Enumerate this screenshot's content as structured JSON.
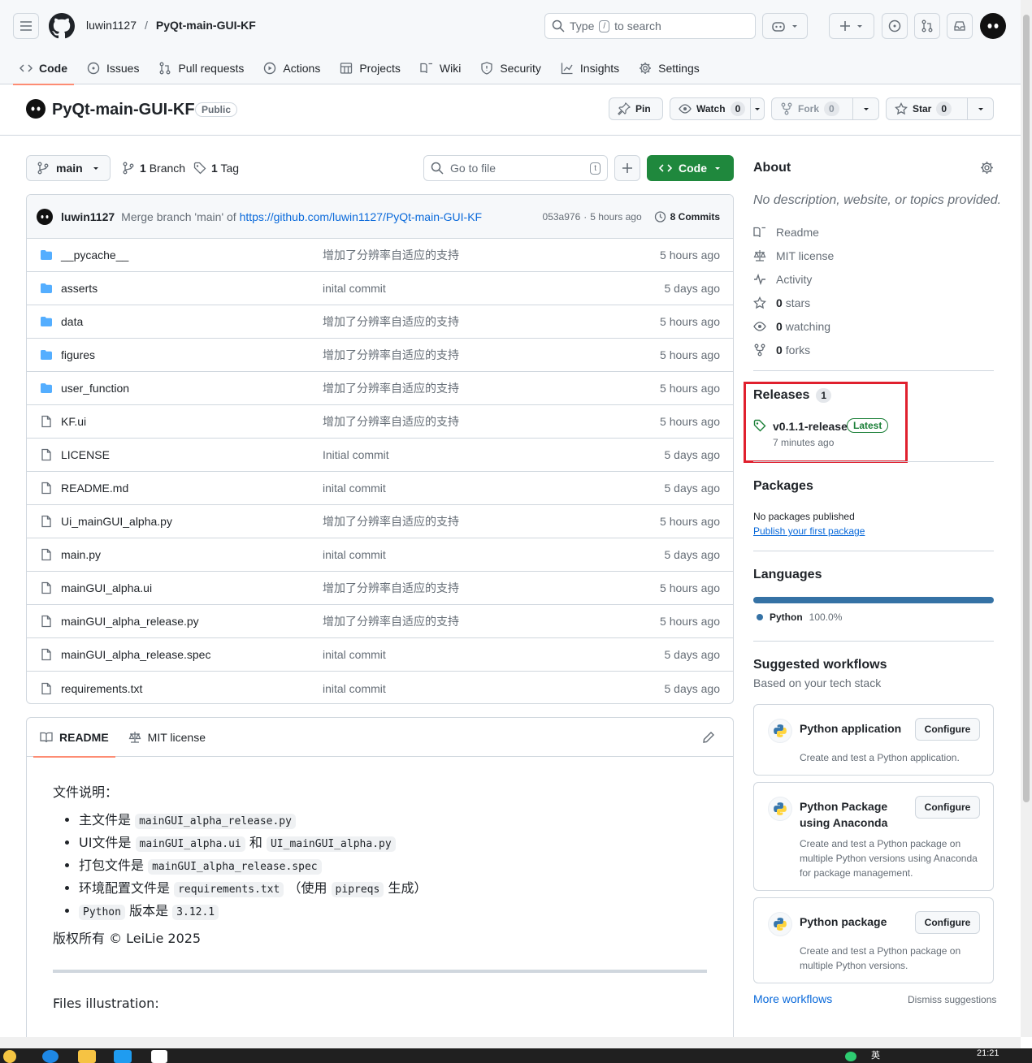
{
  "header": {
    "owner": "luwin1127",
    "separator": "/",
    "repo": "PyQt-main-GUI-KF",
    "search_before": "Type",
    "search_key": "/",
    "search_after": "to search"
  },
  "nav_tabs": [
    {
      "label": "Code",
      "icon": "code-icon"
    },
    {
      "label": "Issues",
      "icon": "issue-icon"
    },
    {
      "label": "Pull requests",
      "icon": "pull-request-icon"
    },
    {
      "label": "Actions",
      "icon": "play-icon"
    },
    {
      "label": "Projects",
      "icon": "table-icon"
    },
    {
      "label": "Wiki",
      "icon": "book-icon"
    },
    {
      "label": "Security",
      "icon": "shield-icon"
    },
    {
      "label": "Insights",
      "icon": "graph-icon"
    },
    {
      "label": "Settings",
      "icon": "gear-icon"
    }
  ],
  "repo_bar": {
    "name": "PyQt-main-GUI-KF",
    "visibility": "Public",
    "pin": "Pin",
    "watch": "Watch",
    "watch_count": "0",
    "fork": "Fork",
    "fork_count": "0",
    "star": "Star",
    "star_count": "0"
  },
  "toolbar": {
    "branch": "main",
    "branches_count": "1",
    "branches_label": "Branch",
    "tags_count": "1",
    "tags_label": "Tag",
    "goto_placeholder": "Go to file",
    "goto_key": "t",
    "code_label": "Code"
  },
  "latest_commit": {
    "author": "luwin1127",
    "message": "Merge branch 'main' of",
    "link": "https://github.com/luwin1127/PyQt-main-GUI-KF",
    "hash": "053a976",
    "sep": "·",
    "time": "5 hours ago",
    "commits": "8 Commits"
  },
  "files": [
    {
      "name": "__pycache__",
      "type": "dir",
      "message": "增加了分辨率自适应的支持",
      "time": "5 hours ago"
    },
    {
      "name": "asserts",
      "type": "dir",
      "message": "inital commit",
      "time": "5 days ago"
    },
    {
      "name": "data",
      "type": "dir",
      "message": "增加了分辨率自适应的支持",
      "time": "5 hours ago"
    },
    {
      "name": "figures",
      "type": "dir",
      "message": "增加了分辨率自适应的支持",
      "time": "5 hours ago"
    },
    {
      "name": "user_function",
      "type": "dir",
      "message": "增加了分辨率自适应的支持",
      "time": "5 hours ago"
    },
    {
      "name": "KF.ui",
      "type": "file",
      "message": "增加了分辨率自适应的支持",
      "time": "5 hours ago"
    },
    {
      "name": "LICENSE",
      "type": "file",
      "message": "Initial commit",
      "time": "5 days ago"
    },
    {
      "name": "README.md",
      "type": "file",
      "message": "inital commit",
      "time": "5 days ago"
    },
    {
      "name": "Ui_mainGUI_alpha.py",
      "type": "file",
      "message": "增加了分辨率自适应的支持",
      "time": "5 hours ago"
    },
    {
      "name": "main.py",
      "type": "file",
      "message": "inital commit",
      "time": "5 days ago"
    },
    {
      "name": "mainGUI_alpha.ui",
      "type": "file",
      "message": "增加了分辨率自适应的支持",
      "time": "5 hours ago"
    },
    {
      "name": "mainGUI_alpha_release.py",
      "type": "file",
      "message": "增加了分辨率自适应的支持",
      "time": "5 hours ago"
    },
    {
      "name": "mainGUI_alpha_release.spec",
      "type": "file",
      "message": "inital commit",
      "time": "5 days ago"
    },
    {
      "name": "requirements.txt",
      "type": "file",
      "message": "inital commit",
      "time": "5 days ago"
    }
  ],
  "readme": {
    "tab_readme": "README",
    "tab_license": "MIT license",
    "heading": "文件说明：",
    "items": [
      {
        "prefix": "主文件是",
        "code1": "mainGUI_alpha_release.py",
        "mid": "",
        "code2": "",
        "suffix": ""
      },
      {
        "prefix": "UI文件是",
        "code1": "mainGUI_alpha.ui",
        "mid": "和",
        "code2": "UI_mainGUI_alpha.py",
        "suffix": ""
      },
      {
        "prefix": "打包文件是",
        "code1": "mainGUI_alpha_release.spec",
        "mid": "",
        "code2": "",
        "suffix": ""
      },
      {
        "prefix": "环境配置文件是",
        "code1": "requirements.txt",
        "mid": "（使用",
        "code2": "pipreqs",
        "suffix": "生成）"
      },
      {
        "prefix": "",
        "code1": "Python",
        "mid": "版本是",
        "code2": "3.12.1",
        "suffix": ""
      }
    ],
    "copyright": "版权所有 © LeiLie 2025",
    "files_illustration": "Files illustration:"
  },
  "about": {
    "title": "About",
    "description": "No description, website, or topics provided.",
    "items": [
      {
        "icon": "book-icon",
        "bold": "",
        "label": "Readme"
      },
      {
        "icon": "law-icon",
        "bold": "",
        "label": "MIT license"
      },
      {
        "icon": "pulse-icon",
        "bold": "",
        "label": "Activity"
      },
      {
        "icon": "star-icon",
        "bold": "0",
        "label": "stars"
      },
      {
        "icon": "eye-icon",
        "bold": "0",
        "label": "watching"
      },
      {
        "icon": "fork-icon",
        "bold": "0",
        "label": "forks"
      }
    ]
  },
  "releases": {
    "title": "Releases",
    "count": "1",
    "name": "v0.1.1-release",
    "badge": "Latest",
    "time": "7 minutes ago"
  },
  "packages": {
    "title": "Packages",
    "none": "No packages published",
    "link": "Publish your first package"
  },
  "languages": {
    "title": "Languages",
    "name": "Python",
    "percent": "100.0%",
    "share": 1.0,
    "color": "#3572A5"
  },
  "workflows": {
    "title": "Suggested workflows",
    "subtitle": "Based on your tech stack",
    "cards": [
      {
        "title": "Python application",
        "desc": "Create and test a Python application.",
        "button": "Configure"
      },
      {
        "title": "Python Package using Anaconda",
        "desc": "Create and test a Python package on multiple Python versions using Anaconda for package management.",
        "button": "Configure"
      },
      {
        "title": "Python package",
        "desc": "Create and test a Python package on multiple Python versions.",
        "button": "Configure"
      }
    ],
    "more": "More workflows",
    "dismiss": "Dismiss suggestions"
  },
  "taskbar": {
    "ime": "英",
    "time": "21:21"
  }
}
